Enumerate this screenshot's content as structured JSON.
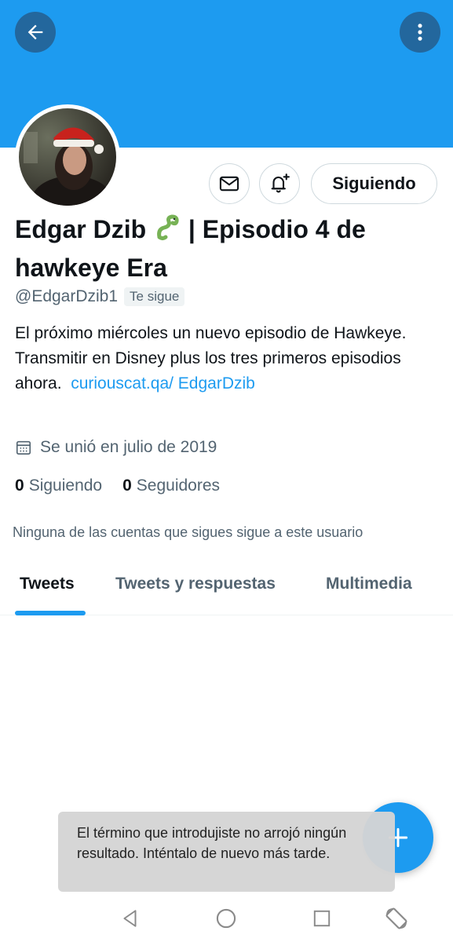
{
  "header": {
    "back_icon": "arrow-left-icon",
    "more_icon": "more-vertical-icon"
  },
  "profile": {
    "name_prefix": "Edgar Dzib",
    "name_emoji": "snake-emoji",
    "name_suffix": "| Episodio 4 de hawkeye Era",
    "handle": "@EdgarDzib1",
    "follows_you": "Te sigue",
    "bio_text": "El próximo miércoles un nuevo episodio de Hawkeye. Transmitir en Disney plus los tres primeros episodios ahora.",
    "bio_link": "curiouscat.qa/ EdgarDzib",
    "joined": "Se unió en julio de 2019",
    "following_count": "0",
    "following_label": "Siguiendo",
    "followers_count": "0",
    "followers_label": "Seguidores",
    "followed_by_text": "Ninguna de las cuentas que sigues sigue a este usuario"
  },
  "actions": {
    "message_icon": "envelope-icon",
    "notify_icon": "bell-plus-icon",
    "follow_label": "Siguiendo"
  },
  "tabs": [
    {
      "label": "Tweets",
      "active": true
    },
    {
      "label": "Tweets y respuestas",
      "active": false
    },
    {
      "label": "Multimedia",
      "active": false
    }
  ],
  "fab_icon": "plus-icon",
  "toast": {
    "message": "El término que introdujiste no arrojó ningún resultado. Inténtalo de nuevo más tarde."
  },
  "system_nav": {
    "back": "triangle-back-icon",
    "home": "circle-home-icon",
    "recent": "square-recent-icon",
    "rotate": "rotate-screen-icon"
  },
  "colors": {
    "accent": "#1d9bf0",
    "text_primary": "#0f1419",
    "text_secondary": "#536471",
    "border": "#cfd9de"
  }
}
